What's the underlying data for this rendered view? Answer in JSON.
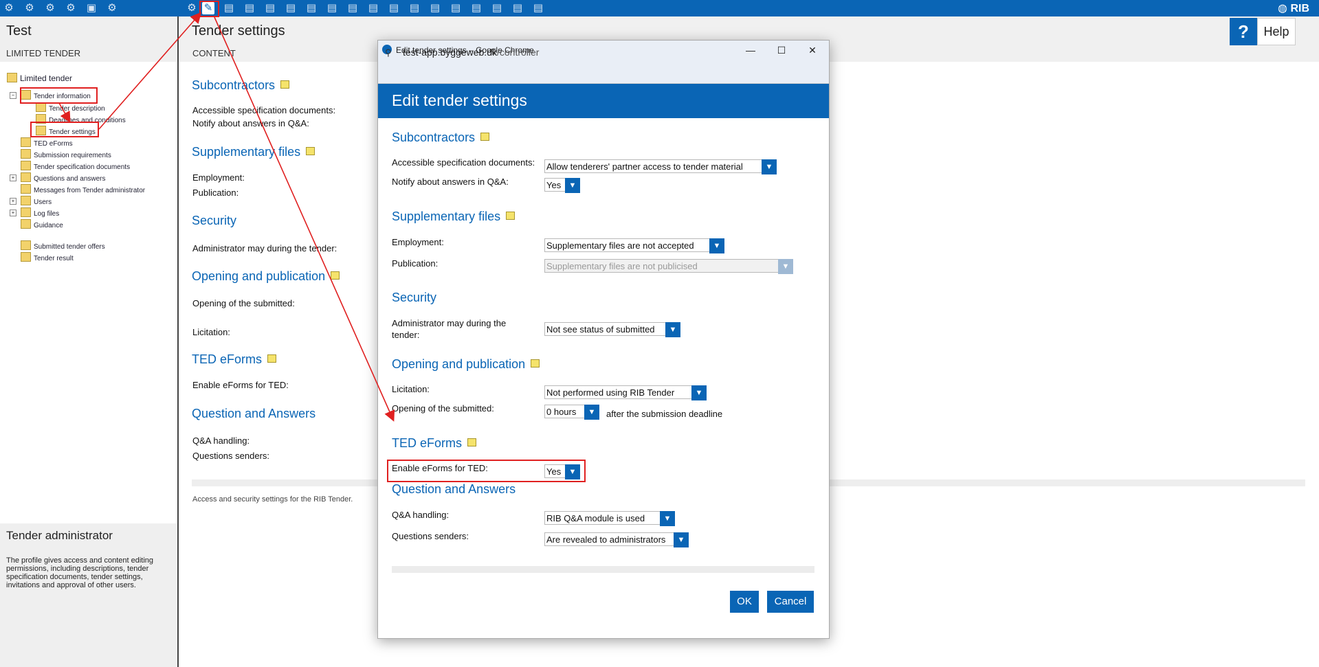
{
  "app": {
    "brand": "RIB"
  },
  "left": {
    "title": "Test",
    "subtitle": "LIMITED TENDER",
    "tree": {
      "root": "Limited tender",
      "tender_information": "Tender information",
      "tender_description": "Tender description",
      "deadlines": "Deadlines and conditions",
      "tender_settings": "Tender settings",
      "ted_eforms": "TED eForms",
      "submission_requirements": "Submission requirements",
      "tender_spec_docs": "Tender specification documents",
      "questions_answers": "Questions and answers",
      "messages": "Messages from Tender administrator",
      "users": "Users",
      "log_files": "Log files",
      "guidance": "Guidance",
      "submitted_offers": "Submitted tender offers",
      "tender_result": "Tender result"
    },
    "admin_title": "Tender administrator",
    "admin_text": "The profile gives access and content editing permissions, including descriptions, tender specification documents, tender settings, invitations and approval of other users."
  },
  "main": {
    "title": "Tender settings",
    "content_label": "CONTENT",
    "sections": {
      "subcontractors": "Subcontractors",
      "supplementary": "Supplementary files",
      "security": "Security",
      "opening": "Opening and publication",
      "ted": "TED eForms",
      "qa": "Question and Answers"
    },
    "labels": {
      "accessible": "Accessible specification documents:",
      "notify": "Notify about answers in Q&A:",
      "employment": "Employment:",
      "publication": "Publication:",
      "admin_may": "Administrator may during the tender:",
      "opening_submitted": "Opening of the submitted:",
      "licitation": "Licitation:",
      "enable_eforms": "Enable eForms for TED:",
      "qa_handling": "Q&A handling:",
      "question_senders": "Questions senders:"
    },
    "footer": "Access and security settings for the RIB Tender."
  },
  "help": {
    "icon": "?",
    "label": "Help"
  },
  "dialog": {
    "window_title": "Edit tender settings – Google Chrome",
    "url_host": "test-app.byggeweb.dk",
    "url_path": "/controller",
    "header": "Edit tender settings",
    "sections": {
      "subcontractors": "Subcontractors",
      "supplementary": "Supplementary files",
      "security": "Security",
      "opening": "Opening and publication",
      "ted": "TED eForms",
      "qa": "Question and Answers"
    },
    "labels": {
      "accessible": "Accessible specification documents:",
      "notify": "Notify about answers in Q&A:",
      "employment": "Employment:",
      "publication": "Publication:",
      "admin_may_1": "Administrator may during the",
      "admin_may_2": "tender:",
      "licitation": "Licitation:",
      "opening_submitted": "Opening of the submitted:",
      "after_deadline": "after the submission deadline",
      "enable_eforms": "Enable eForms for TED:",
      "qa_handling": "Q&A handling:",
      "question_senders": "Questions senders:"
    },
    "values": {
      "accessible": "Allow tenderers' partner access to tender material",
      "notify": "Yes",
      "employment": "Supplementary files are not accepted",
      "publication": "Supplementary files are not publicised",
      "admin_may": "Not see status of submitted",
      "licitation": "Not performed using RIB Tender",
      "opening_hours": "0 hours",
      "enable_eforms": "Yes",
      "qa_handling": "RIB Q&A module is used",
      "question_senders": "Are revealed to administrators"
    },
    "ok": "OK",
    "cancel": "Cancel"
  },
  "colors": {
    "accent": "#0a65b5",
    "annotation": "#e02020"
  }
}
